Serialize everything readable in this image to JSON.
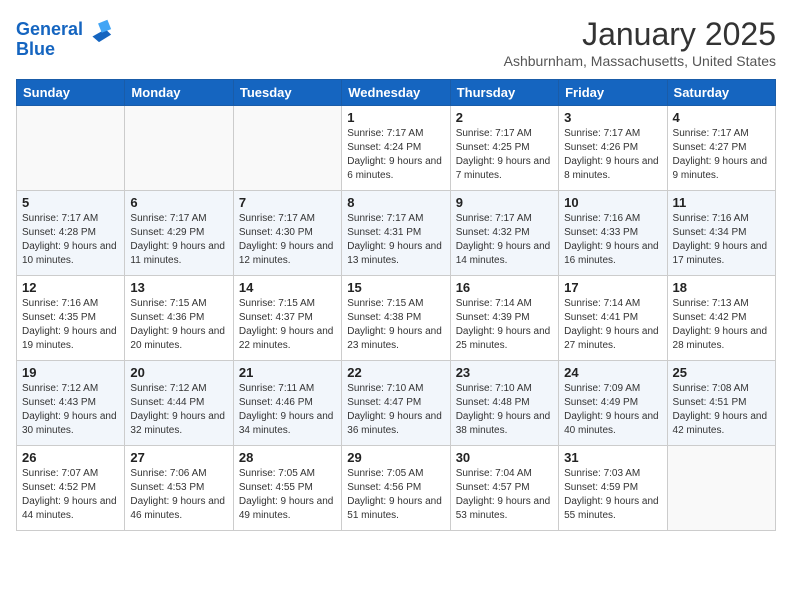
{
  "header": {
    "logo_line1": "General",
    "logo_line2": "Blue",
    "month": "January 2025",
    "location": "Ashburnham, Massachusetts, United States"
  },
  "weekdays": [
    "Sunday",
    "Monday",
    "Tuesday",
    "Wednesday",
    "Thursday",
    "Friday",
    "Saturday"
  ],
  "weeks": [
    [
      {
        "day": "",
        "info": ""
      },
      {
        "day": "",
        "info": ""
      },
      {
        "day": "",
        "info": ""
      },
      {
        "day": "1",
        "info": "Sunrise: 7:17 AM\nSunset: 4:24 PM\nDaylight: 9 hours and 6 minutes."
      },
      {
        "day": "2",
        "info": "Sunrise: 7:17 AM\nSunset: 4:25 PM\nDaylight: 9 hours and 7 minutes."
      },
      {
        "day": "3",
        "info": "Sunrise: 7:17 AM\nSunset: 4:26 PM\nDaylight: 9 hours and 8 minutes."
      },
      {
        "day": "4",
        "info": "Sunrise: 7:17 AM\nSunset: 4:27 PM\nDaylight: 9 hours and 9 minutes."
      }
    ],
    [
      {
        "day": "5",
        "info": "Sunrise: 7:17 AM\nSunset: 4:28 PM\nDaylight: 9 hours and 10 minutes."
      },
      {
        "day": "6",
        "info": "Sunrise: 7:17 AM\nSunset: 4:29 PM\nDaylight: 9 hours and 11 minutes."
      },
      {
        "day": "7",
        "info": "Sunrise: 7:17 AM\nSunset: 4:30 PM\nDaylight: 9 hours and 12 minutes."
      },
      {
        "day": "8",
        "info": "Sunrise: 7:17 AM\nSunset: 4:31 PM\nDaylight: 9 hours and 13 minutes."
      },
      {
        "day": "9",
        "info": "Sunrise: 7:17 AM\nSunset: 4:32 PM\nDaylight: 9 hours and 14 minutes."
      },
      {
        "day": "10",
        "info": "Sunrise: 7:16 AM\nSunset: 4:33 PM\nDaylight: 9 hours and 16 minutes."
      },
      {
        "day": "11",
        "info": "Sunrise: 7:16 AM\nSunset: 4:34 PM\nDaylight: 9 hours and 17 minutes."
      }
    ],
    [
      {
        "day": "12",
        "info": "Sunrise: 7:16 AM\nSunset: 4:35 PM\nDaylight: 9 hours and 19 minutes."
      },
      {
        "day": "13",
        "info": "Sunrise: 7:15 AM\nSunset: 4:36 PM\nDaylight: 9 hours and 20 minutes."
      },
      {
        "day": "14",
        "info": "Sunrise: 7:15 AM\nSunset: 4:37 PM\nDaylight: 9 hours and 22 minutes."
      },
      {
        "day": "15",
        "info": "Sunrise: 7:15 AM\nSunset: 4:38 PM\nDaylight: 9 hours and 23 minutes."
      },
      {
        "day": "16",
        "info": "Sunrise: 7:14 AM\nSunset: 4:39 PM\nDaylight: 9 hours and 25 minutes."
      },
      {
        "day": "17",
        "info": "Sunrise: 7:14 AM\nSunset: 4:41 PM\nDaylight: 9 hours and 27 minutes."
      },
      {
        "day": "18",
        "info": "Sunrise: 7:13 AM\nSunset: 4:42 PM\nDaylight: 9 hours and 28 minutes."
      }
    ],
    [
      {
        "day": "19",
        "info": "Sunrise: 7:12 AM\nSunset: 4:43 PM\nDaylight: 9 hours and 30 minutes."
      },
      {
        "day": "20",
        "info": "Sunrise: 7:12 AM\nSunset: 4:44 PM\nDaylight: 9 hours and 32 minutes."
      },
      {
        "day": "21",
        "info": "Sunrise: 7:11 AM\nSunset: 4:46 PM\nDaylight: 9 hours and 34 minutes."
      },
      {
        "day": "22",
        "info": "Sunrise: 7:10 AM\nSunset: 4:47 PM\nDaylight: 9 hours and 36 minutes."
      },
      {
        "day": "23",
        "info": "Sunrise: 7:10 AM\nSunset: 4:48 PM\nDaylight: 9 hours and 38 minutes."
      },
      {
        "day": "24",
        "info": "Sunrise: 7:09 AM\nSunset: 4:49 PM\nDaylight: 9 hours and 40 minutes."
      },
      {
        "day": "25",
        "info": "Sunrise: 7:08 AM\nSunset: 4:51 PM\nDaylight: 9 hours and 42 minutes."
      }
    ],
    [
      {
        "day": "26",
        "info": "Sunrise: 7:07 AM\nSunset: 4:52 PM\nDaylight: 9 hours and 44 minutes."
      },
      {
        "day": "27",
        "info": "Sunrise: 7:06 AM\nSunset: 4:53 PM\nDaylight: 9 hours and 46 minutes."
      },
      {
        "day": "28",
        "info": "Sunrise: 7:05 AM\nSunset: 4:55 PM\nDaylight: 9 hours and 49 minutes."
      },
      {
        "day": "29",
        "info": "Sunrise: 7:05 AM\nSunset: 4:56 PM\nDaylight: 9 hours and 51 minutes."
      },
      {
        "day": "30",
        "info": "Sunrise: 7:04 AM\nSunset: 4:57 PM\nDaylight: 9 hours and 53 minutes."
      },
      {
        "day": "31",
        "info": "Sunrise: 7:03 AM\nSunset: 4:59 PM\nDaylight: 9 hours and 55 minutes."
      },
      {
        "day": "",
        "info": ""
      }
    ]
  ]
}
